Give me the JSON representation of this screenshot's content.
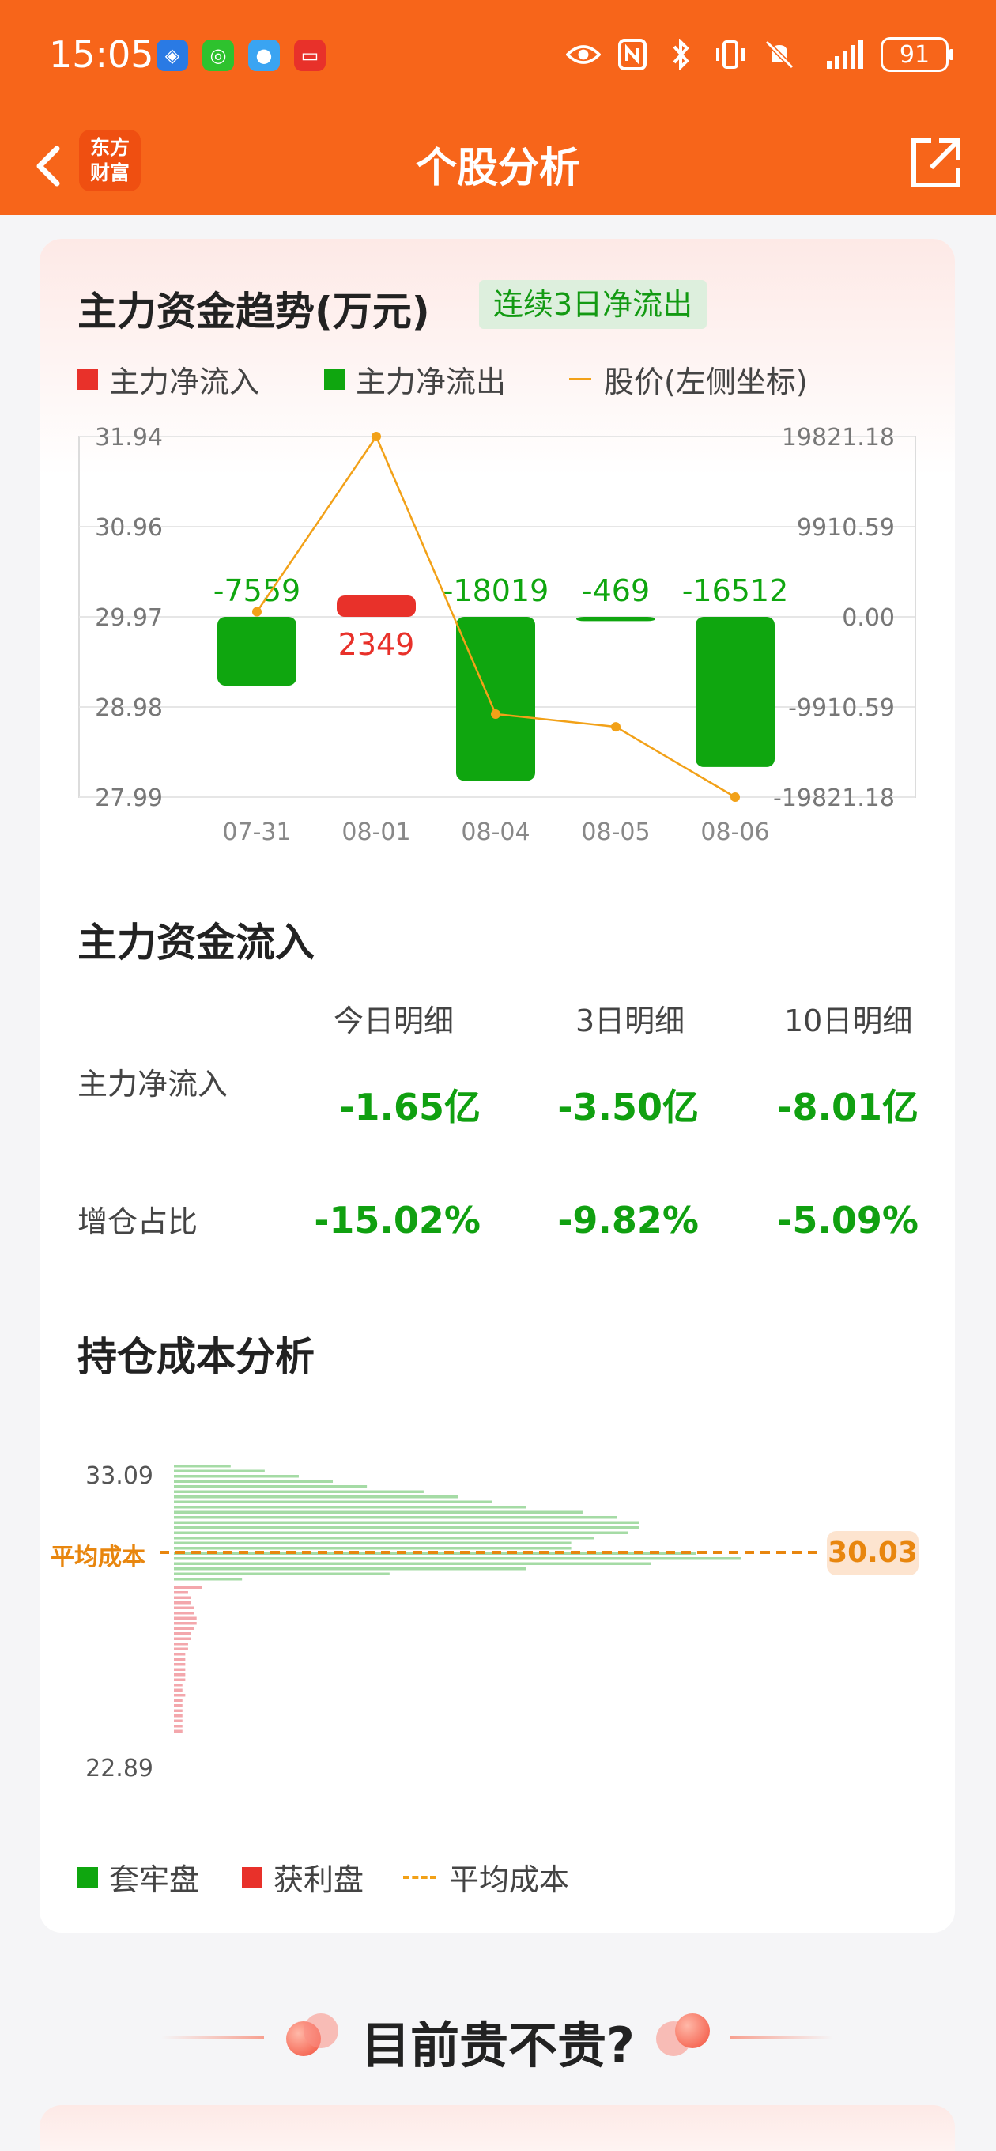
{
  "status_bar": {
    "time": "15:05",
    "apps": [
      "shield-app-icon",
      "wechat-icon",
      "message-icon",
      "red-app-icon"
    ],
    "battery": "91",
    "icons": [
      "eye-icon",
      "nfc-icon",
      "bluetooth-icon",
      "vibrate-icon",
      "mute-icon",
      "signal-icon"
    ]
  },
  "nav": {
    "title": "个股分析",
    "logo_line1": "东方",
    "logo_line2": "财富"
  },
  "trend": {
    "title": "主力资金趋势(万元)",
    "badge": "连续3日净流出",
    "legend": {
      "inflow": "主力净流入",
      "outflow": "主力净流出",
      "price": "股价(左侧坐标)"
    }
  },
  "chart_data": {
    "type": "bar",
    "categories": [
      "07-31",
      "08-01",
      "08-04",
      "08-05",
      "08-06"
    ],
    "series": [
      {
        "name": "主力净流入/流出",
        "values": [
          -7559,
          2349,
          -18019,
          -469,
          -16512
        ]
      },
      {
        "name": "股价(左侧坐标)",
        "values": [
          30.02,
          31.94,
          28.9,
          28.76,
          27.99
        ]
      }
    ],
    "left_ticks": [
      "31.94",
      "30.96",
      "29.97",
      "28.98",
      "27.99"
    ],
    "right_ticks": [
      "19821.18",
      "9910.59",
      "0.00",
      "-9910.59",
      "-19821.18"
    ],
    "ylim_left": [
      27.99,
      31.94
    ],
    "ylim_right": [
      -19821.18,
      19821.18
    ],
    "grid": true,
    "colors": {
      "inflow": "#e8312a",
      "outflow": "#0fa60f",
      "price": "#f2a118"
    }
  },
  "inflow": {
    "title": "主力资金流入",
    "headers": [
      "今日明细",
      "3日明细",
      "10日明细"
    ],
    "rows": [
      {
        "label": "主力净流入",
        "values": [
          "-1.65亿",
          "-3.50亿",
          "-8.01亿"
        ]
      },
      {
        "label": "增仓占比",
        "values": [
          "-15.02%",
          "-9.82%",
          "-5.09%"
        ]
      }
    ]
  },
  "cost": {
    "title": "持仓成本分析",
    "top_price": "33.09",
    "bottom_price": "22.89",
    "avg_label": "平均成本",
    "avg_value": "30.03",
    "legend": {
      "locked": "套牢盘",
      "profit": "获利盘",
      "avg": "平均成本"
    },
    "locked_fractions": [
      0.1,
      0.16,
      0.22,
      0.28,
      0.34,
      0.44,
      0.5,
      0.56,
      0.62,
      0.72,
      0.78,
      0.82,
      0.82,
      0.8,
      0.74,
      0.7,
      0.7,
      0.92,
      1.0,
      0.84,
      0.62,
      0.38,
      0.12
    ],
    "profit_fractions": [
      0.05,
      0.025,
      0.03,
      0.03,
      0.035,
      0.035,
      0.04,
      0.04,
      0.035,
      0.03,
      0.03,
      0.025,
      0.025,
      0.02,
      0.02,
      0.02,
      0.02,
      0.02,
      0.02,
      0.015,
      0.015,
      0.02,
      0.015,
      0.015,
      0.015,
      0.015,
      0.015,
      0.015,
      0.015
    ],
    "colors": {
      "locked": "#a5dba5",
      "profit": "#f3a7ac",
      "avg": "#e8860e"
    }
  },
  "bottom": {
    "title": "目前贵不贵?"
  }
}
